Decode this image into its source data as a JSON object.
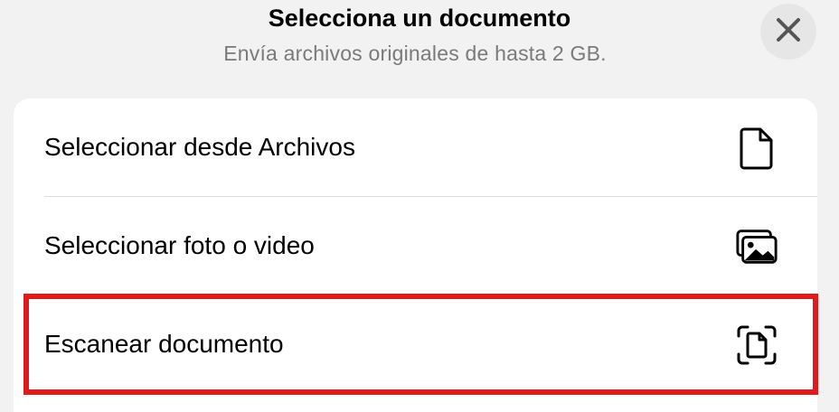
{
  "header": {
    "title": "Selecciona un documento",
    "subtitle": "Envía archivos originales de hasta 2 GB."
  },
  "close_button": {
    "icon": "close-icon"
  },
  "options": [
    {
      "label": "Seleccionar desde Archivos",
      "icon": "file-icon"
    },
    {
      "label": "Seleccionar foto o video",
      "icon": "photo-library-icon"
    },
    {
      "label": "Escanear documento",
      "icon": "scan-document-icon"
    }
  ],
  "annotation": {
    "highlight_color": "#e01b1b",
    "highlighted_option": "Escanear documento"
  }
}
